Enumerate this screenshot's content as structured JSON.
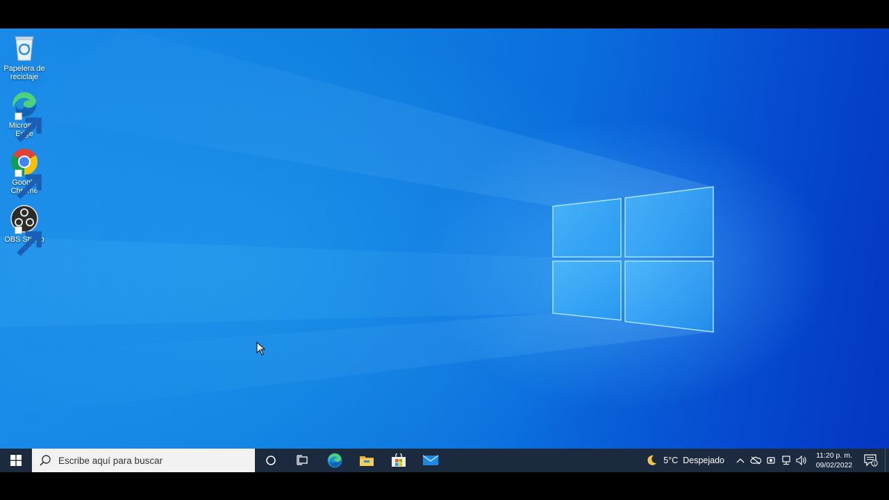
{
  "desktop": {
    "icons": [
      {
        "label_line1": "Papelera de",
        "label_line2": "reciclaje",
        "icon": "recycle-bin-icon"
      },
      {
        "label_line1": "Microsoft",
        "label_line2": "Edge",
        "icon": "edge-icon"
      },
      {
        "label_line1": "Google",
        "label_line2": "Chrome",
        "icon": "chrome-icon"
      },
      {
        "label_line1": "OBS Studio",
        "label_line2": "",
        "icon": "obs-icon"
      }
    ]
  },
  "taskbar": {
    "search_placeholder": "Escribe aquí para buscar",
    "pinned": [
      "cortana-icon",
      "task-view-icon",
      "edge-icon",
      "file-explorer-icon",
      "store-icon",
      "mail-icon"
    ],
    "weather": {
      "icon": "moon-icon",
      "temperature": "5°C",
      "condition": "Despejado"
    },
    "tray": [
      "chevron-up-icon",
      "cloud-offline-icon",
      "meet-now-icon",
      "network-icon",
      "volume-icon"
    ],
    "clock": {
      "time": "11:20 p. m.",
      "date": "09/02/2022"
    },
    "notification_count": "1"
  },
  "colors": {
    "taskbar": "#1b2a3e",
    "desktop_accent": "#0b6fdd",
    "search_box": "#f2f2f2"
  }
}
